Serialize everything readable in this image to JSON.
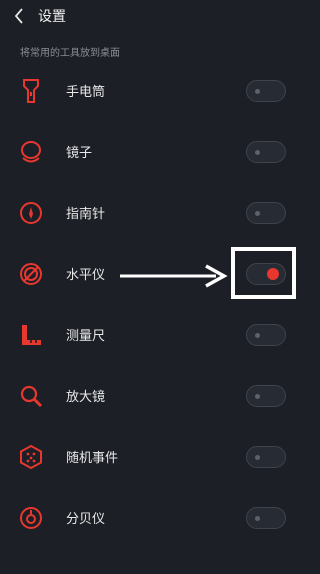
{
  "header": {
    "title": "设置"
  },
  "section": {
    "label": "将常用的工具放到桌面"
  },
  "items": [
    {
      "label": "手电筒",
      "icon": "flashlight-icon",
      "enabled": false
    },
    {
      "label": "镜子",
      "icon": "mirror-icon",
      "enabled": false
    },
    {
      "label": "指南针",
      "icon": "compass-icon",
      "enabled": false
    },
    {
      "label": "水平仪",
      "icon": "level-icon",
      "enabled": true
    },
    {
      "label": "测量尺",
      "icon": "ruler-icon",
      "enabled": false
    },
    {
      "label": "放大镜",
      "icon": "magnifier-icon",
      "enabled": false
    },
    {
      "label": "随机事件",
      "icon": "dice-icon",
      "enabled": false
    },
    {
      "label": "分贝仪",
      "icon": "decibel-icon",
      "enabled": false
    }
  ],
  "colors": {
    "accent": "#e8372f",
    "background": "#1c1f26",
    "annotation": "#ffffff"
  }
}
